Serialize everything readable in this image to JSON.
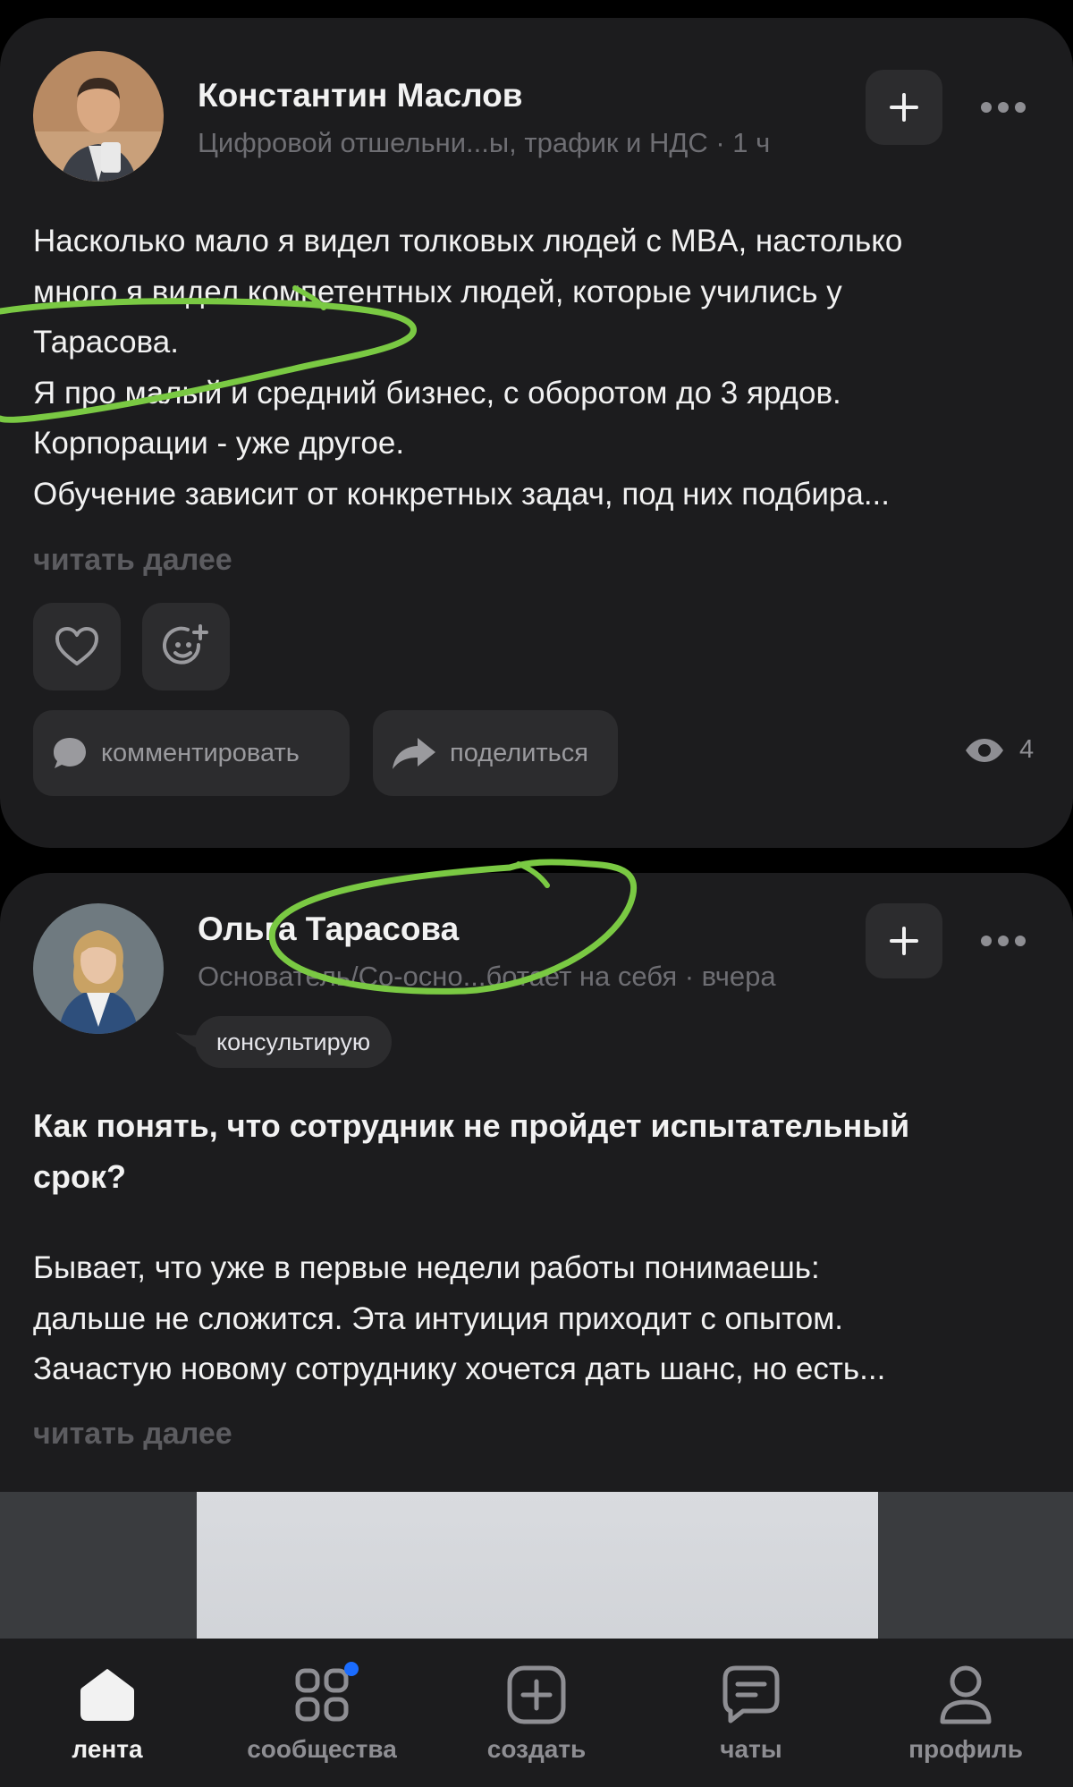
{
  "post1": {
    "author": "Константин Маслов",
    "subtitle": "Цифровой отшельни...ы, трафик и НДС · 1 ч",
    "text_lines": [
      "Насколько мало я видел толковых людей с MBA, настолько",
      "много я видел компетентных людей, которые учились у",
      "Тарасова.",
      "Я про малый и средний бизнес, с оборотом до 3 ярдов.",
      "Корпорации - уже другое.",
      "Обучение зависит от конкретных задач, под них подбира..."
    ],
    "read_more": "читать далее",
    "comment_label": "комментировать",
    "share_label": "поделиться",
    "views": "4"
  },
  "post2": {
    "author": "Ольга Тарасова",
    "subtitle": "Основатель/Со-осно...ботает на себя · вчера",
    "tag": "консультирую",
    "title_lines": [
      "Как понять, что сотрудник не пройдет испытательный",
      "срок?"
    ],
    "text_lines": [
      "Бывает, что уже в первые недели работы понимаешь:",
      "дальше не сложится. Эта интуиция приходит с опытом.",
      "Зачастую новому сотруднику хочется дать шанс, но есть..."
    ],
    "read_more": "читать далее"
  },
  "nav": {
    "items": [
      {
        "label": "лента",
        "icon": "home-icon",
        "active": true
      },
      {
        "label": "сообщества",
        "icon": "grid-icon",
        "badge": true
      },
      {
        "label": "создать",
        "icon": "plus-square-icon"
      },
      {
        "label": "чаты",
        "icon": "chat-icon"
      },
      {
        "label": "профиль",
        "icon": "profile-icon"
      }
    ]
  },
  "colors": {
    "card_bg": "#1c1c1e",
    "button_bg": "#2c2c2e",
    "annotation": "#7ac943",
    "badge": "#1a6cff"
  }
}
